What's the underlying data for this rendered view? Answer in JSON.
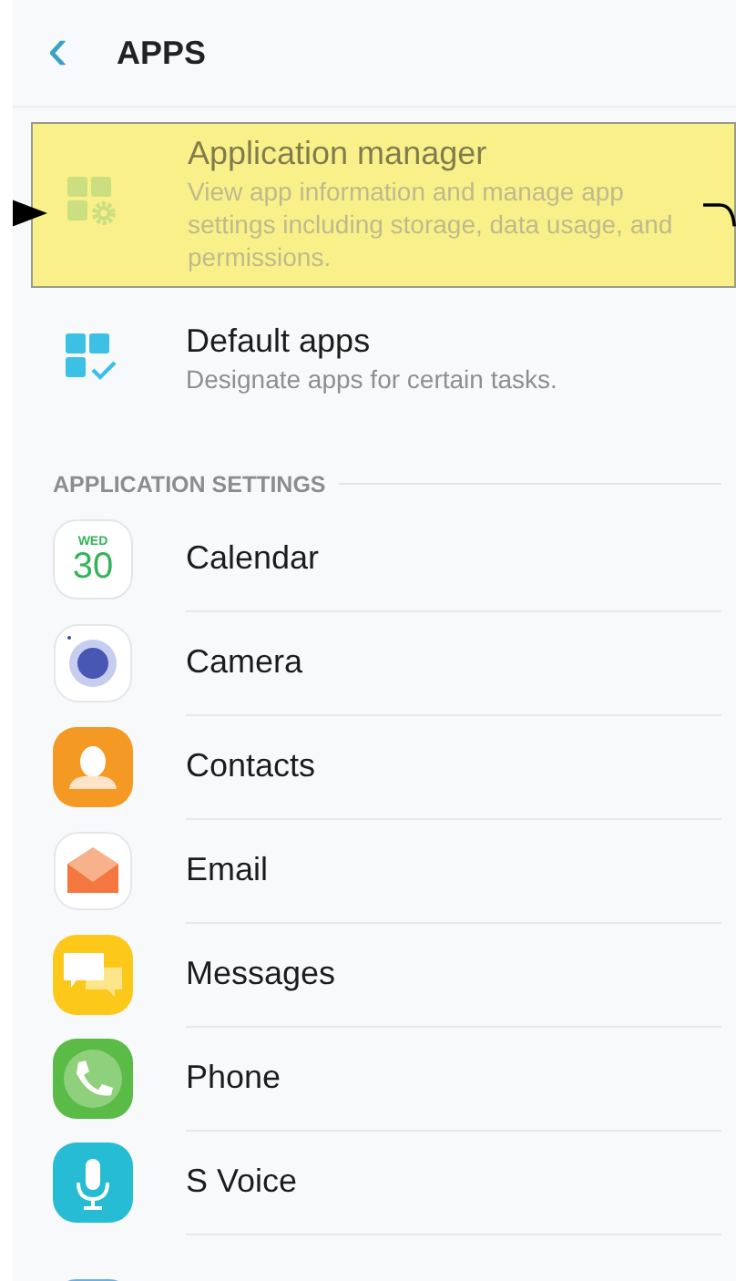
{
  "header": {
    "back_icon": "‹",
    "title": "APPS"
  },
  "top_items": [
    {
      "kind": "manager",
      "title": "Application manager",
      "subtitle": "View app information and manage app settings including storage, data usage, and permissions.",
      "highlighted": true
    },
    {
      "kind": "defaults",
      "title": "Default apps",
      "subtitle": "Designate apps for certain tasks.",
      "highlighted": false
    }
  ],
  "section_title": "APPLICATION SETTINGS",
  "apps": [
    {
      "kind": "calendar",
      "label": "Calendar",
      "icon_day": "WED",
      "icon_date": "30"
    },
    {
      "kind": "camera",
      "label": "Camera"
    },
    {
      "kind": "contacts",
      "label": "Contacts"
    },
    {
      "kind": "email",
      "label": "Email"
    },
    {
      "kind": "messages",
      "label": "Messages"
    },
    {
      "kind": "phone",
      "label": "Phone"
    },
    {
      "kind": "voice",
      "label": "S Voice"
    },
    {
      "kind": "partial"
    }
  ]
}
